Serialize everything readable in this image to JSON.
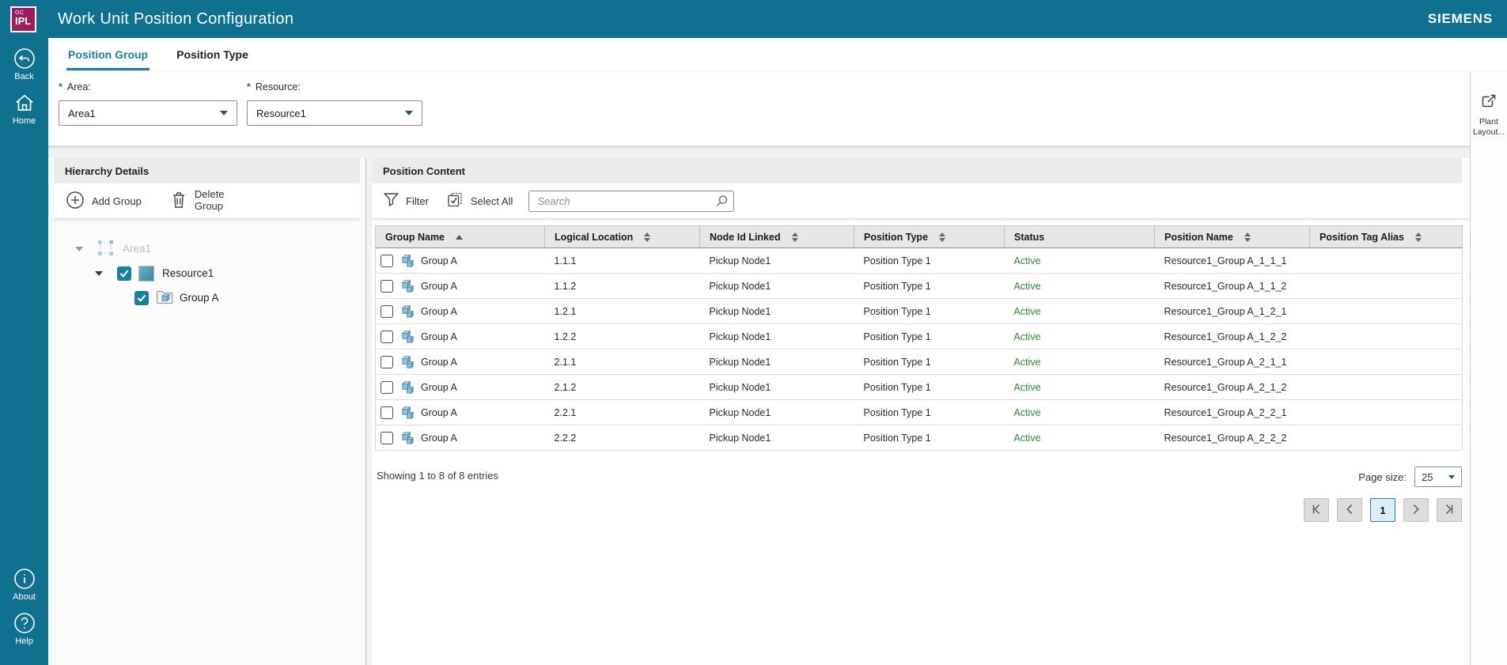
{
  "header": {
    "logo_top": "OC",
    "logo_main": "IPL",
    "title": "Work Unit Position Configuration",
    "brand": "SIEMENS"
  },
  "sidebar": {
    "back_label": "Back",
    "home_label": "Home",
    "about_label": "About",
    "help_label": "Help"
  },
  "tabs": [
    {
      "label": "Position Group",
      "active": true
    },
    {
      "label": "Position Type",
      "active": false
    }
  ],
  "filters": {
    "required_marker": "*",
    "area_label": "Area:",
    "area_value": "Area1",
    "resource_label": "Resource:",
    "resource_value": "Resource1"
  },
  "right_panel": {
    "plant_layout_label": "Plant Layout..."
  },
  "hierarchy": {
    "title": "Hierarchy Details",
    "add_group_label": "Add Group",
    "delete_group_label": "Delete Group",
    "tree": [
      {
        "label": "Area1",
        "level": 0,
        "disabled": true,
        "checked": null
      },
      {
        "label": "Resource1",
        "level": 1,
        "disabled": false,
        "checked": true
      },
      {
        "label": "Group A",
        "level": 2,
        "disabled": false,
        "checked": true
      }
    ]
  },
  "content": {
    "title": "Position Content",
    "filter_label": "Filter",
    "select_all_label": "Select All",
    "search_placeholder": "Search",
    "table": {
      "columns": [
        {
          "label": "Group Name",
          "sort": "asc"
        },
        {
          "label": "Logical Location",
          "sort": "both"
        },
        {
          "label": "Node Id Linked",
          "sort": "both"
        },
        {
          "label": "Position Type",
          "sort": "both"
        },
        {
          "label": "Status",
          "sort": "none"
        },
        {
          "label": "Position Name",
          "sort": "both"
        },
        {
          "label": "Position Tag Alias",
          "sort": "both"
        }
      ],
      "rows": [
        {
          "group_name": "Group A",
          "logical_location": "1.1.1",
          "node_id_linked": "Pickup Node1",
          "position_type": "Position Type 1",
          "status": "Active",
          "position_name": "Resource1_Group A_1_1_1",
          "position_tag_alias": ""
        },
        {
          "group_name": "Group A",
          "logical_location": "1.1.2",
          "node_id_linked": "Pickup Node1",
          "position_type": "Position Type 1",
          "status": "Active",
          "position_name": "Resource1_Group A_1_1_2",
          "position_tag_alias": ""
        },
        {
          "group_name": "Group A",
          "logical_location": "1.2.1",
          "node_id_linked": "Pickup Node1",
          "position_type": "Position Type 1",
          "status": "Active",
          "position_name": "Resource1_Group A_1_2_1",
          "position_tag_alias": ""
        },
        {
          "group_name": "Group A",
          "logical_location": "1.2.2",
          "node_id_linked": "Pickup Node1",
          "position_type": "Position Type 1",
          "status": "Active",
          "position_name": "Resource1_Group A_1_2_2",
          "position_tag_alias": ""
        },
        {
          "group_name": "Group A",
          "logical_location": "2.1.1",
          "node_id_linked": "Pickup Node1",
          "position_type": "Position Type 1",
          "status": "Active",
          "position_name": "Resource1_Group A_2_1_1",
          "position_tag_alias": ""
        },
        {
          "group_name": "Group A",
          "logical_location": "2.1.2",
          "node_id_linked": "Pickup Node1",
          "position_type": "Position Type 1",
          "status": "Active",
          "position_name": "Resource1_Group A_2_1_2",
          "position_tag_alias": ""
        },
        {
          "group_name": "Group A",
          "logical_location": "2.2.1",
          "node_id_linked": "Pickup Node1",
          "position_type": "Position Type 1",
          "status": "Active",
          "position_name": "Resource1_Group A_2_2_1",
          "position_tag_alias": ""
        },
        {
          "group_name": "Group A",
          "logical_location": "2.2.2",
          "node_id_linked": "Pickup Node1",
          "position_type": "Position Type 1",
          "status": "Active",
          "position_name": "Resource1_Group A_2_2_2",
          "position_tag_alias": ""
        }
      ]
    },
    "footer": {
      "showing_text": "Showing 1 to 8 of 8 entries",
      "page_size_label": "Page size:",
      "page_size_value": "25",
      "current_page": "1"
    }
  },
  "colors": {
    "header_teal": "#0f7090",
    "accent_teal": "#1b7e9e",
    "logo_magenta": "#9b1c5f",
    "status_green": "#2e8b2e"
  }
}
